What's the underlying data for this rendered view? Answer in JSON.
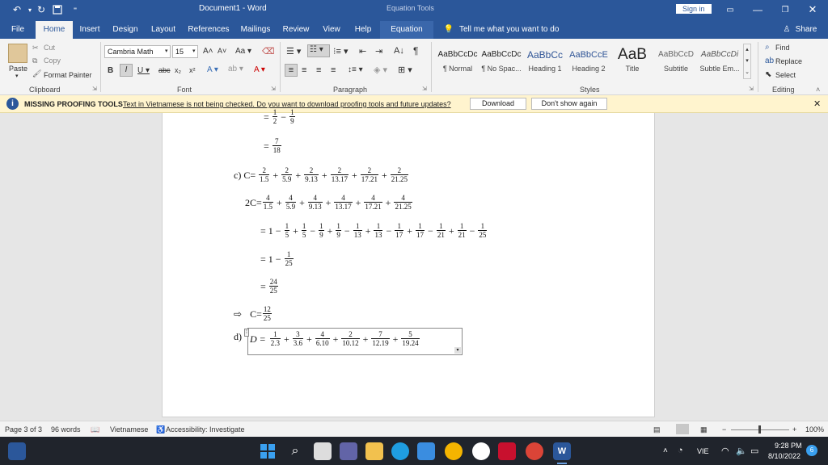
{
  "window": {
    "title": "Document1 - Word",
    "contextual": "Equation Tools",
    "sign_in": "Sign in"
  },
  "tabs": [
    "File",
    "Home",
    "Insert",
    "Design",
    "Layout",
    "References",
    "Mailings",
    "Review",
    "View",
    "Help",
    "Equation"
  ],
  "tell_me": "Tell me what you want to do",
  "share": "Share",
  "clipboard": {
    "paste": "Paste",
    "cut": "Cut",
    "copy": "Copy",
    "format_painter": "Format Painter",
    "label": "Clipboard"
  },
  "font": {
    "name": "Cambria Math",
    "size": "15",
    "label": "Font"
  },
  "paragraph": {
    "label": "Paragraph"
  },
  "styles": {
    "label": "Styles",
    "items": [
      {
        "preview": "AaBbCcDc",
        "name": "¶ Normal"
      },
      {
        "preview": "AaBbCcDc",
        "name": "¶ No Spac..."
      },
      {
        "preview": "AaBbCc",
        "name": "Heading 1"
      },
      {
        "preview": "AaBbCcE",
        "name": "Heading 2"
      },
      {
        "preview": "AaB",
        "name": "Title"
      },
      {
        "preview": "AaBbCcD",
        "name": "Subtitle"
      },
      {
        "preview": "AaBbCcDi",
        "name": "Subtle Em..."
      }
    ]
  },
  "editing": {
    "find": "Find",
    "replace": "Replace",
    "select": "Select",
    "label": "Editing"
  },
  "message": {
    "title": "MISSING PROOFING TOOLS",
    "text": "Text in Vietnamese is not being checked. Do you want to download proofing tools and future updates?",
    "download": "Download",
    "dont_show": "Don't show again"
  },
  "math": {
    "l1_frac1": {
      "n": "1",
      "d": "2"
    },
    "l1_frac2": {
      "n": "1",
      "d": "9"
    },
    "l2": {
      "n": "7",
      "d": "18"
    },
    "c_label": "c) C=",
    "c_terms": [
      {
        "n": "2",
        "d": "1.5"
      },
      {
        "n": "2",
        "d": "5.9"
      },
      {
        "n": "2",
        "d": "9.13"
      },
      {
        "n": "2",
        "d": "13.17"
      },
      {
        "n": "2",
        "d": "17.21"
      },
      {
        "n": "2",
        "d": "21.25"
      }
    ],
    "c2_label": "2C=",
    "c2_terms": [
      {
        "n": "4",
        "d": "1.5"
      },
      {
        "n": "4",
        "d": "5.9"
      },
      {
        "n": "4",
        "d": "9.13"
      },
      {
        "n": "4",
        "d": "13.17"
      },
      {
        "n": "4",
        "d": "17.21"
      },
      {
        "n": "4",
        "d": "21.25"
      }
    ],
    "tele_fracs": [
      {
        "n": "1",
        "d": "5"
      },
      {
        "n": "1",
        "d": "5"
      },
      {
        "n": "1",
        "d": "9"
      },
      {
        "n": "1",
        "d": "9"
      },
      {
        "n": "1",
        "d": "13"
      },
      {
        "n": "1",
        "d": "13"
      },
      {
        "n": "1",
        "d": "17"
      },
      {
        "n": "1",
        "d": "17"
      },
      {
        "n": "1",
        "d": "21"
      },
      {
        "n": "1",
        "d": "21"
      },
      {
        "n": "1",
        "d": "25"
      }
    ],
    "tele_ops": [
      "−",
      "+",
      "−",
      "+",
      "−",
      "+",
      "−",
      "+",
      "−",
      "+",
      "−"
    ],
    "one": "1",
    "r3": {
      "n": "1",
      "d": "25"
    },
    "r4": {
      "n": "24",
      "d": "25"
    },
    "implies": "⇨",
    "r5_label": "C=",
    "r5": {
      "n": "12",
      "d": "25"
    },
    "d_label": "d)",
    "d_var": "D =",
    "d_terms": [
      {
        "n": "1",
        "d": "2.3"
      },
      {
        "n": "3",
        "d": "3.6"
      },
      {
        "n": "4",
        "d": "6.10"
      },
      {
        "n": "2",
        "d": "10.12"
      },
      {
        "n": "7",
        "d": "12.19"
      },
      {
        "n": "5",
        "d": "19.24"
      }
    ]
  },
  "status": {
    "page": "Page 3 of 3",
    "words": "96 words",
    "language": "Vietnamese",
    "accessibility": "Accessibility: Investigate",
    "zoom": "100%"
  },
  "tray": {
    "lang": "VIE",
    "time": "9:28 PM",
    "date": "8/10/2022",
    "badge": "6"
  },
  "colors": {
    "accent": "#2b579a",
    "message_bg": "#fff4ce",
    "taskbar": "#20242c"
  }
}
